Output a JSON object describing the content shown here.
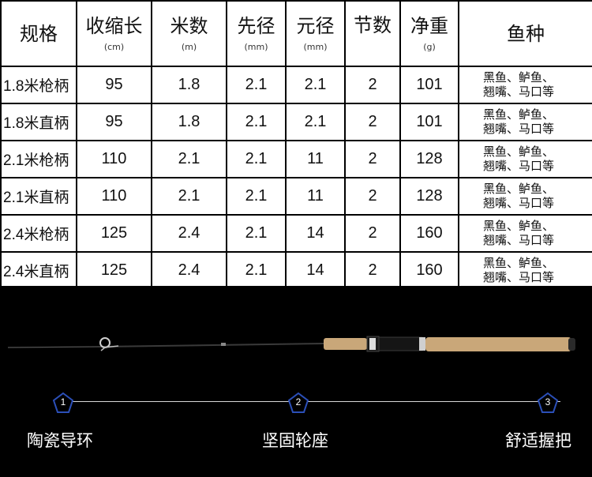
{
  "table": {
    "headers": [
      {
        "main": "规格",
        "unit": ""
      },
      {
        "main": "收缩长",
        "unit": "(cm)"
      },
      {
        "main": "米数",
        "unit": "(m)"
      },
      {
        "main": "先径",
        "unit": "(mm)"
      },
      {
        "main": "元径",
        "unit": "(mm)"
      },
      {
        "main": "节数",
        "unit": ""
      },
      {
        "main": "净重",
        "unit": "(g)"
      },
      {
        "main": "鱼种",
        "unit": ""
      }
    ],
    "rows": [
      {
        "spec": "1.8米枪柄",
        "length": "95",
        "meters": "1.8",
        "tip": "2.1",
        "butt": "2.1",
        "sections": "2",
        "weight": "101",
        "fish1": "黑鱼、鲈鱼、",
        "fish2": "翘嘴、马口等"
      },
      {
        "spec": "1.8米直柄",
        "length": "95",
        "meters": "1.8",
        "tip": "2.1",
        "butt": "2.1",
        "sections": "2",
        "weight": "101",
        "fish1": "黑鱼、鲈鱼、",
        "fish2": "翘嘴、马口等"
      },
      {
        "spec": "2.1米枪柄",
        "length": "110",
        "meters": "2.1",
        "tip": "2.1",
        "butt": "11",
        "sections": "2",
        "weight": "128",
        "fish1": "黑鱼、鲈鱼、",
        "fish2": "翘嘴、马口等"
      },
      {
        "spec": "2.1米直柄",
        "length": "110",
        "meters": "2.1",
        "tip": "2.1",
        "butt": "11",
        "sections": "2",
        "weight": "128",
        "fish1": "黑鱼、鲈鱼、",
        "fish2": "翘嘴、马口等"
      },
      {
        "spec": "2.4米枪柄",
        "length": "125",
        "meters": "2.4",
        "tip": "2.1",
        "butt": "14",
        "sections": "2",
        "weight": "160",
        "fish1": "黑鱼、鲈鱼、",
        "fish2": "翘嘴、马口等"
      },
      {
        "spec": "2.4米直柄",
        "length": "125",
        "meters": "2.4",
        "tip": "2.1",
        "butt": "14",
        "sections": "2",
        "weight": "160",
        "fish1": "黑鱼、鲈鱼、",
        "fish2": "翘嘴、马口等"
      }
    ]
  },
  "features": [
    {
      "number": "1",
      "label": "陶瓷导环"
    },
    {
      "number": "2",
      "label": "坚固轮座"
    },
    {
      "number": "3",
      "label": "舒适握把"
    }
  ],
  "colors": {
    "background": "#000000",
    "table_bg": "#ffffff",
    "marker_stroke": "#2b4fb8",
    "cork": "#c9a779"
  }
}
